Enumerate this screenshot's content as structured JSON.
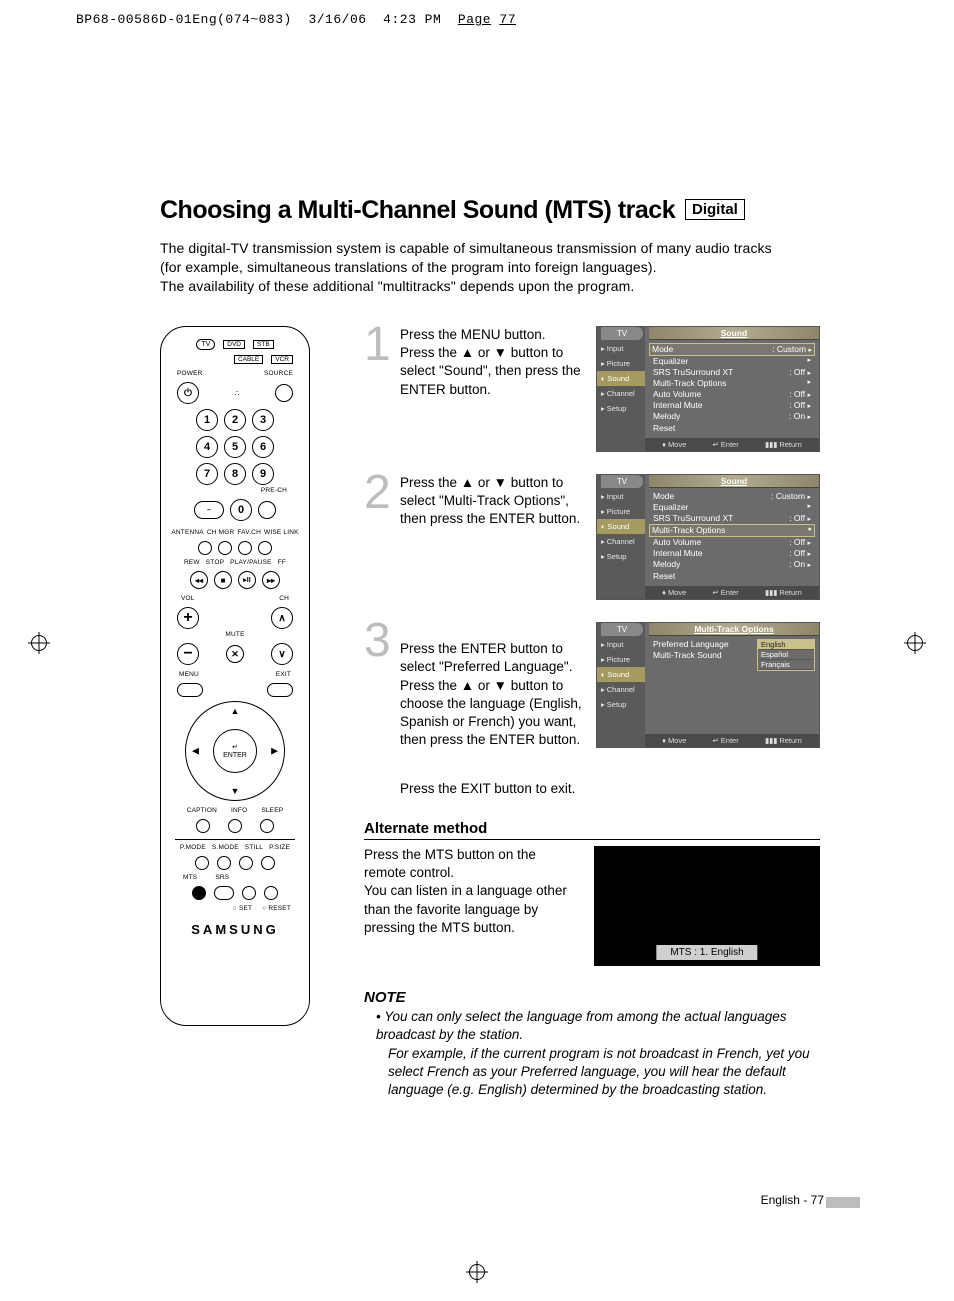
{
  "printmark": {
    "file": "BP68-00586D-01Eng(074~083)",
    "date": "3/16/06",
    "time": "4:23 PM",
    "page_label": "Page",
    "page_no": "77"
  },
  "title": "Choosing a Multi-Channel Sound (MTS) track",
  "badge": "Digital",
  "intro_line1": "The digital-TV transmission system is capable of simultaneous transmission of many audio tracks",
  "intro_line2": "(for example, simultaneous translations of the program into foreign languages).",
  "intro_line3": "The availability of these additional \"multitracks\" depends upon the program.",
  "remote": {
    "selector_row1": [
      "TV",
      "DVD",
      "STB"
    ],
    "selector_row2": [
      "CABLE",
      "VCR"
    ],
    "power": "POWER",
    "source": "SOURCE",
    "numbers": [
      "1",
      "2",
      "3",
      "4",
      "5",
      "6",
      "7",
      "8",
      "9",
      "0"
    ],
    "prech": "PRE-CH",
    "dash": "–",
    "row_labels1": [
      "ANTENNA",
      "CH MGR",
      "FAV.CH",
      "WISE LINK"
    ],
    "row_labels2": [
      "REW",
      "STOP",
      "PLAY/PAUSE",
      "FF"
    ],
    "vol": "VOL",
    "ch": "CH",
    "mute": "MUTE",
    "menu": "MENU",
    "exit": "EXIT",
    "enter_top": "↵",
    "enter": "ENTER",
    "row_labels3": [
      "CAPTION",
      "INFO",
      "SLEEP"
    ],
    "row_labels4": [
      "P.MODE",
      "S.MODE",
      "STILL",
      "P.SIZE"
    ],
    "row_labels5": [
      "MTS",
      "SRS"
    ],
    "row_labels6": [
      "SET",
      "RESET"
    ],
    "brand": "SAMSUNG"
  },
  "steps": [
    {
      "n": "1",
      "text": "Press the MENU button.\nPress the ▲ or ▼ button to select \"Sound\", then press the ENTER button."
    },
    {
      "n": "2",
      "text": "Press the ▲ or ▼ button to select \"Multi-Track Options\", then press the ENTER button."
    },
    {
      "n": "3",
      "text": "Press the ENTER button to select \"Preferred Language\". Press the ▲ or ▼ button to choose the language (English, Spanish or French) you want, then press the ENTER button."
    }
  ],
  "step3_extra": "Press the EXIT button to exit.",
  "osd_common": {
    "tv": "TV",
    "tabs": [
      "Input",
      "Picture",
      "Sound",
      "Channel",
      "Setup"
    ],
    "footer": {
      "move": "Move",
      "enter": "Enter",
      "return": "Return"
    }
  },
  "osd1": {
    "title": "Sound",
    "active_tab": 2,
    "items": [
      {
        "label": "Mode",
        "value": ": Custom",
        "arrow": true
      },
      {
        "label": "Equalizer",
        "value": "",
        "arrow": true
      },
      {
        "label": "SRS TruSurround XT",
        "value": ": Off",
        "arrow": true
      },
      {
        "label": "Multi-Track Options",
        "value": "",
        "arrow": true
      },
      {
        "label": "Auto Volume",
        "value": ": Off",
        "arrow": true
      },
      {
        "label": "Internal Mute",
        "value": ": Off",
        "arrow": true
      },
      {
        "label": "Melody",
        "value": ": On",
        "arrow": true
      },
      {
        "label": "Reset",
        "value": "",
        "arrow": false
      }
    ],
    "selected": 0
  },
  "osd2": {
    "title": "Sound",
    "active_tab": 2,
    "items": [
      {
        "label": "Mode",
        "value": ": Custom",
        "arrow": true
      },
      {
        "label": "Equalizer",
        "value": "",
        "arrow": true
      },
      {
        "label": "SRS TruSurround XT",
        "value": ": Off",
        "arrow": true
      },
      {
        "label": "Multi-Track Options",
        "value": "",
        "arrow": true
      },
      {
        "label": "Auto Volume",
        "value": ": Off",
        "arrow": true
      },
      {
        "label": "Internal Mute",
        "value": ": Off",
        "arrow": true
      },
      {
        "label": "Melody",
        "value": ": On",
        "arrow": true
      },
      {
        "label": "Reset",
        "value": "",
        "arrow": false
      }
    ],
    "selected": 3
  },
  "osd3": {
    "title": "Multi-Track Options",
    "active_tab": 2,
    "left_items": [
      {
        "label": "Preferred Language"
      },
      {
        "label": "Multi-Track Sound"
      }
    ],
    "languages": [
      "English",
      "Español",
      "Français"
    ],
    "lang_selected": 0
  },
  "alternate": {
    "heading": "Alternate method",
    "text": "Press the MTS button on the remote control.\nYou can listen in a language other than the favorite language by pressing the MTS button.",
    "pill": "MTS : 1. English"
  },
  "note": {
    "heading": "NOTE",
    "bullet": "You can only select the language from among the actual languages broadcast by the station.",
    "cont1": "For example, if the current program is not broadcast in French, yet you select French as your Preferred language, you will hear the default language (e.g. English) determined by the broadcasting station."
  },
  "page_footer": {
    "text": "English - 77"
  }
}
